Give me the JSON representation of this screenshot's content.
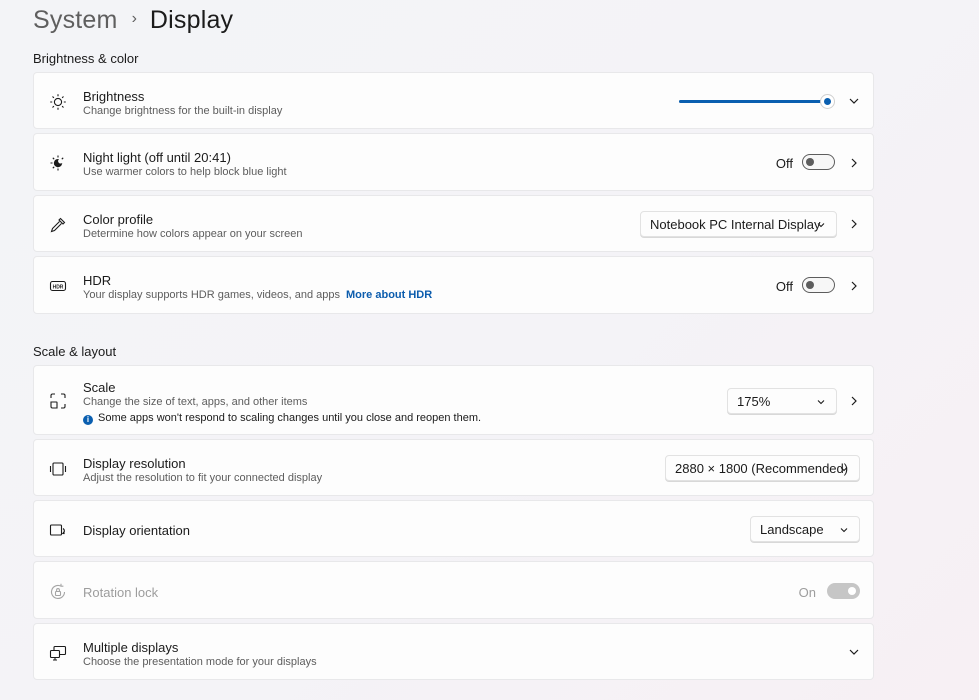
{
  "breadcrumb": {
    "parent": "System",
    "separator": "›",
    "current": "Display"
  },
  "sections": {
    "brightness_color": "Brightness & color",
    "scale_layout": "Scale & layout"
  },
  "brightness": {
    "title": "Brightness",
    "subtitle": "Change brightness for the built-in display",
    "level_percent": 100
  },
  "night_light": {
    "title": "Night light (off until 20:41)",
    "subtitle": "Use warmer colors to help block blue light",
    "state": "Off"
  },
  "color_profile": {
    "title": "Color profile",
    "subtitle": "Determine how colors appear on your screen",
    "value": "Notebook PC Internal Display"
  },
  "hdr": {
    "title": "HDR",
    "subtitle": "Your display supports HDR games, videos, and apps",
    "link": "More about HDR",
    "state": "Off"
  },
  "scale": {
    "title": "Scale",
    "subtitle": "Change the size of text, apps, and other items",
    "notice_icon": "i",
    "notice": "Some apps won't respond to scaling changes until you close and reopen them.",
    "value": "175%"
  },
  "resolution": {
    "title": "Display resolution",
    "subtitle": "Adjust the resolution to fit your connected display",
    "value": "2880 × 1800 (Recommended)"
  },
  "orientation": {
    "title": "Display orientation",
    "value": "Landscape"
  },
  "rotation_lock": {
    "title": "Rotation lock",
    "state": "On"
  },
  "multiple_displays": {
    "title": "Multiple displays",
    "subtitle": "Choose the presentation mode for your displays"
  },
  "colors": {
    "accent": "#0a5fb0",
    "link": "#0b5cad",
    "card": "#fdfdfd"
  }
}
